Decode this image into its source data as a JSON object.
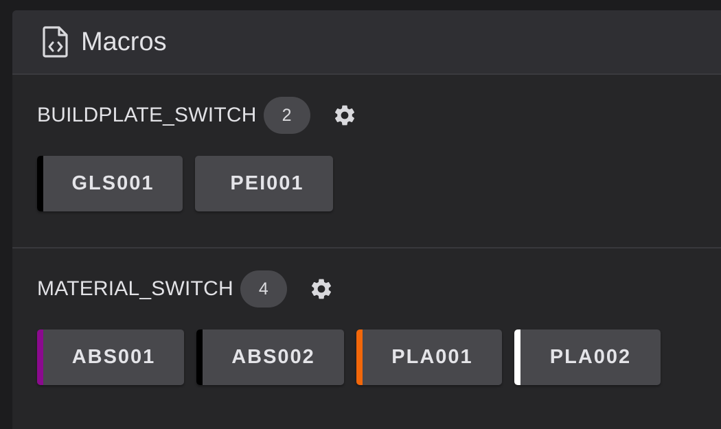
{
  "panel": {
    "title": "Macros",
    "icon": "file-code-icon"
  },
  "groups": [
    {
      "name": "BUILDPLATE_SWITCH",
      "count": "2",
      "settings_icon": "gear-icon",
      "macros": [
        {
          "label": "GLS001",
          "color": "#000000"
        },
        {
          "label": "PEI001",
          "color": null
        }
      ]
    },
    {
      "name": "MATERIAL_SWITCH",
      "count": "4",
      "settings_icon": "gear-icon",
      "macros": [
        {
          "label": "ABS001",
          "color": "#8B0A8E"
        },
        {
          "label": "ABS002",
          "color": "#000000"
        },
        {
          "label": "PLA001",
          "color": "#F2670A"
        },
        {
          "label": "PLA002",
          "color": "#FFFFFF"
        }
      ]
    }
  ]
}
